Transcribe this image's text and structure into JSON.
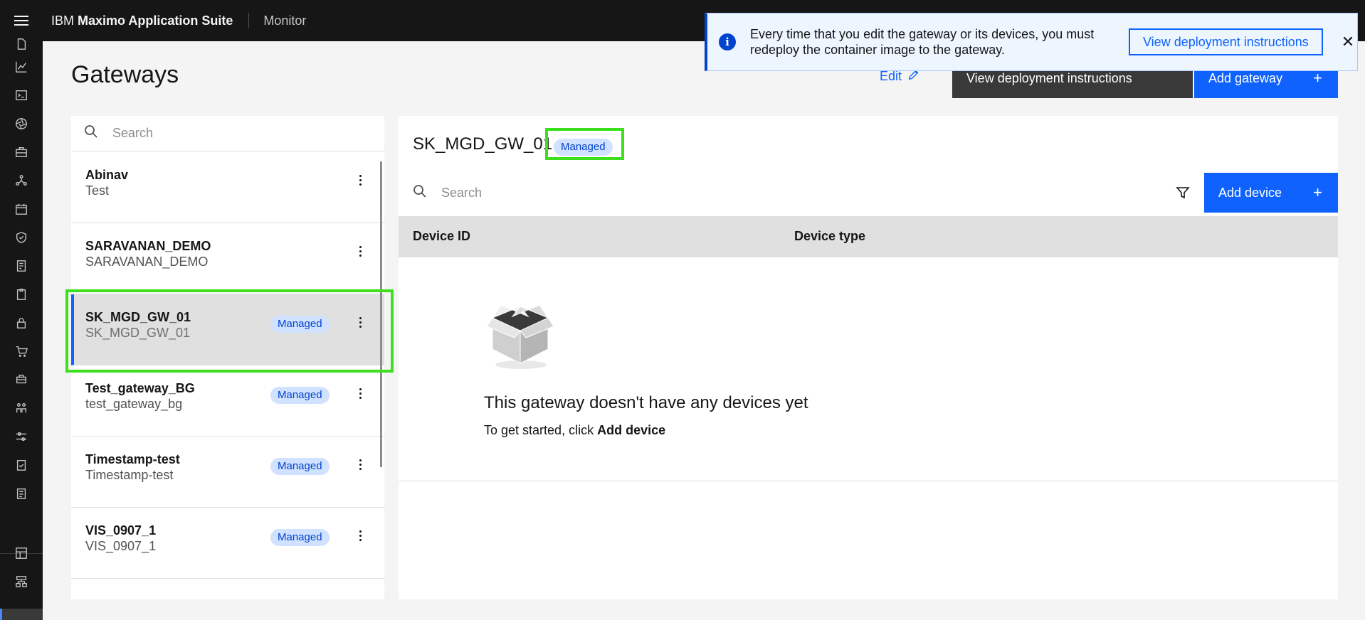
{
  "header": {
    "brand_prefix": "IBM ",
    "brand_name": "Maximo Application Suite",
    "app_name": "Monitor"
  },
  "page": {
    "title": "Gateways",
    "edit_label": "Edit",
    "deploy_button": "View deployment instructions",
    "add_gateway_button": "Add gateway",
    "plus": "+"
  },
  "notification": {
    "icon": "i",
    "text": "Every time that you edit the gateway or its devices, you must redeploy the container image to the gateway.",
    "button": "View deployment instructions",
    "close": "✕"
  },
  "list": {
    "search_placeholder": "Search",
    "items": [
      {
        "name": "Abinav",
        "sub": "Test",
        "tag": ""
      },
      {
        "name": "SARAVANAN_DEMO",
        "sub": "SARAVANAN_DEMO",
        "tag": ""
      },
      {
        "name": "SK_MGD_GW_01",
        "sub": "SK_MGD_GW_01",
        "tag": "Managed"
      },
      {
        "name": "Test_gateway_BG",
        "sub": "test_gateway_bg",
        "tag": "Managed"
      },
      {
        "name": "Timestamp-test",
        "sub": "Timestamp-test",
        "tag": "Managed"
      },
      {
        "name": "VIS_0907_1",
        "sub": "VIS_0907_1",
        "tag": "Managed"
      }
    ]
  },
  "detail": {
    "title": "SK_MGD_GW_01",
    "tag": "Managed",
    "search_placeholder": "Search",
    "add_device_button": "Add device",
    "columns": [
      "Device ID",
      "Device type"
    ],
    "empty_title": "This gateway doesn't have any devices yet",
    "empty_sub_prefix": "To get started, click ",
    "empty_sub_action": "Add device"
  },
  "colors": {
    "primary": "#0f62fe",
    "header_bg": "#161616",
    "tag_bg": "#d0e2ff",
    "highlight": "#3ce01c"
  }
}
